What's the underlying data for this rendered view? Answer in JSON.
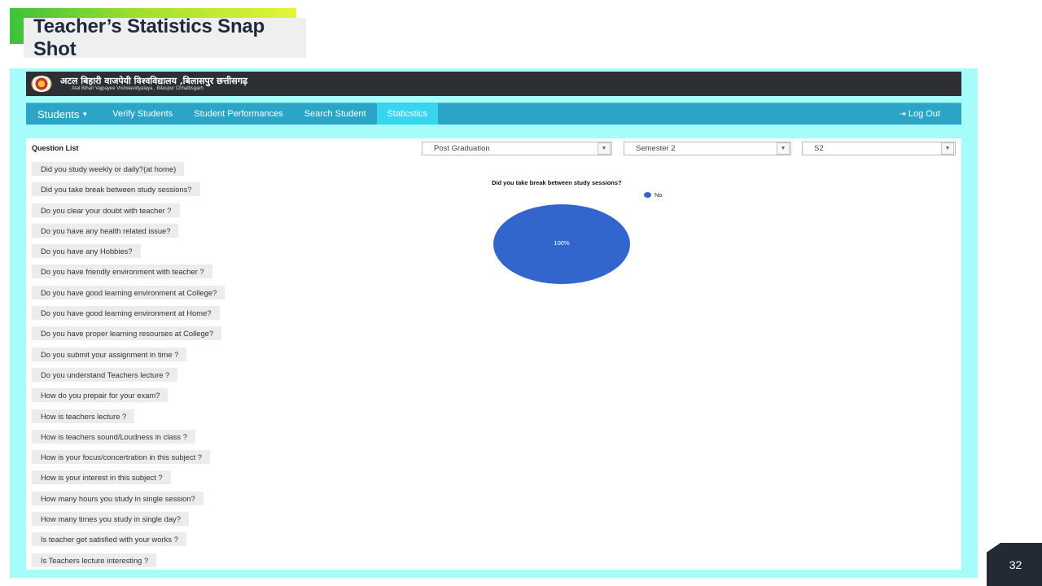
{
  "slide": {
    "title": "Teacher’s Statistics Snap Shot",
    "page_number": "32"
  },
  "app": {
    "university_hindi": "अटल बिहारी वाजपेयी विश्वविद्यालय ,बिलासपुर छत्तीसगढ़",
    "university_english": "Atal Bihari Vajpayee Vishwavidyalaya , Bilaspur Chhattisgarh",
    "nav": {
      "students": "Students",
      "verify": "Verify Students",
      "performances": "Student Performances",
      "search": "Search Student",
      "statistics": "Staticstics",
      "logout": "Log Out"
    },
    "colors": {
      "header": "#2d2f33",
      "nav": "#2ca4c6",
      "nav_active": "#38d5ef",
      "frame": "#a6fbfb"
    }
  },
  "question_list": {
    "title": "Question List",
    "items": [
      "Did you study weekly or daily?(at home)",
      "Did you take break between study sessions?",
      "Do you clear your doubt with teacher ?",
      "Do you have any health related issue?",
      "Do you have any Hobbies?",
      "Do you have friendly environment with teacher ?",
      "Do you have good learning environment at College?",
      "Do you have good learning environment at Home?",
      "Do you have proper learning resourses at College?",
      "Do you submit your assignment in time ?",
      "Do you understand Teachers lecture ?",
      "How do you prepair for your exam?",
      "How is teachers lecture ?",
      "How is teachers sound/Loudness in class ?",
      "How is your focus/concertration in this subject ?",
      "How is your interest in this subject ?",
      "How many hours you study in single session?",
      "How many times you study in single day?",
      "Is teacher get satisfied with your works ?",
      "Is Teachers lecture interesting ?"
    ]
  },
  "filters": {
    "program": "Post Graduation",
    "semester": "Semester 2",
    "subject": "S2"
  },
  "chart_data": {
    "type": "pie",
    "title": "Did you take break between study sessions?",
    "categories": [
      "No"
    ],
    "values": [
      100
    ],
    "data_labels": [
      "100%"
    ],
    "colors": [
      "#3366cc"
    ],
    "legend": "top-right"
  }
}
